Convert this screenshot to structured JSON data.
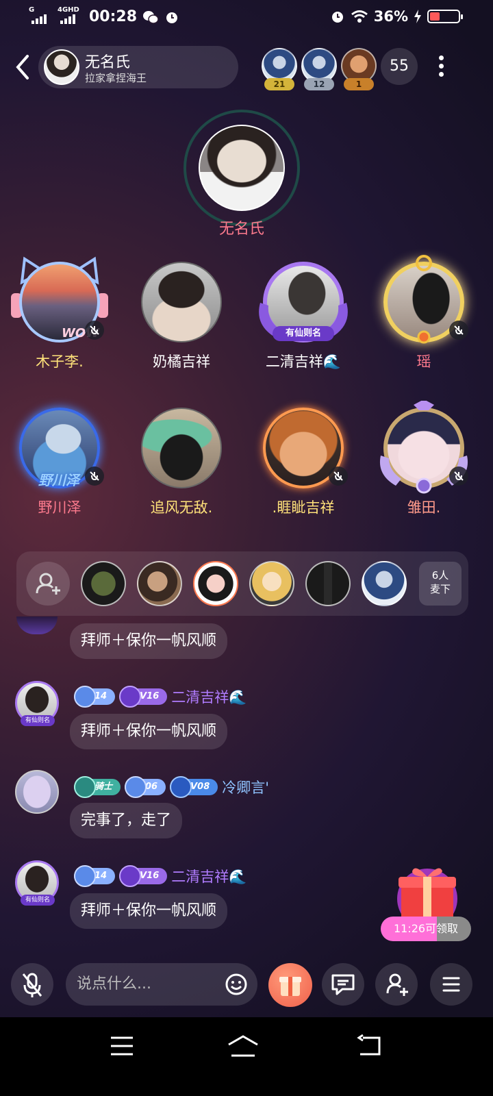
{
  "status_bar": {
    "signal1_label": "G",
    "signal2_label": "4GHD",
    "time": "00:28",
    "battery_percent": "36%",
    "battery_level": 0.36
  },
  "header": {
    "room_name": "无名氏",
    "room_subtitle": "拉家拿捏海王",
    "top_contributors": [
      {
        "rank": "21",
        "badge_color": "#d4b43a"
      },
      {
        "rank": "12",
        "badge_color": "#9aa4b4"
      },
      {
        "rank": "1",
        "badge_color": "#c8802a"
      }
    ],
    "online_count": "55"
  },
  "host": {
    "name": "无名氏"
  },
  "seats": [
    {
      "name": "木子李.",
      "name_color": "#ffe27a",
      "muted": true
    },
    {
      "name": "奶橘吉祥",
      "name_color": "#ffffff",
      "muted": false
    },
    {
      "name": "二清吉祥🌊",
      "name_color": "#ffffff",
      "muted": false
    },
    {
      "name": "瑶",
      "name_color": "#ff7b8e",
      "muted": true
    },
    {
      "name": "野川泽",
      "name_color": "#ff7b8e",
      "muted": true
    },
    {
      "name": "追风无敌.",
      "name_color": "#ffe27a",
      "muted": false
    },
    {
      "name": ".睚眦吉祥",
      "name_color": "#ffe27a",
      "muted": true
    },
    {
      "name": "雏田.",
      "name_color": "#ff9a8a",
      "muted": true
    }
  ],
  "seat_frame_texts": {
    "seat1": "WOW",
    "seat3": "有仙则名",
    "seat5": "野川泽"
  },
  "queue": {
    "count_line1": "6人",
    "count_line2": "麦下"
  },
  "chat": {
    "partial_message": "拜师＋保你一帆风顺",
    "messages": [
      {
        "level": "14",
        "vip": "V16",
        "name": "二清吉祥🌊",
        "name_color": "#b07cff",
        "text": "拜师＋保你一帆风顺",
        "avatar_tag": "有仙则名"
      },
      {
        "title": "骑士",
        "level": "06",
        "vip": "V08",
        "name": "冷卿言'",
        "name_color": "#8fc3ff",
        "text": "完事了，走了"
      },
      {
        "level": "14",
        "vip": "V16",
        "name": "二清吉祥🌊",
        "name_color": "#b07cff",
        "text": "拜师＋保你一帆风顺",
        "avatar_tag": "有仙则名"
      }
    ]
  },
  "gift_promo": {
    "timer_text": "11:26可领取"
  },
  "bottom_bar": {
    "input_placeholder": "说点什么..."
  }
}
